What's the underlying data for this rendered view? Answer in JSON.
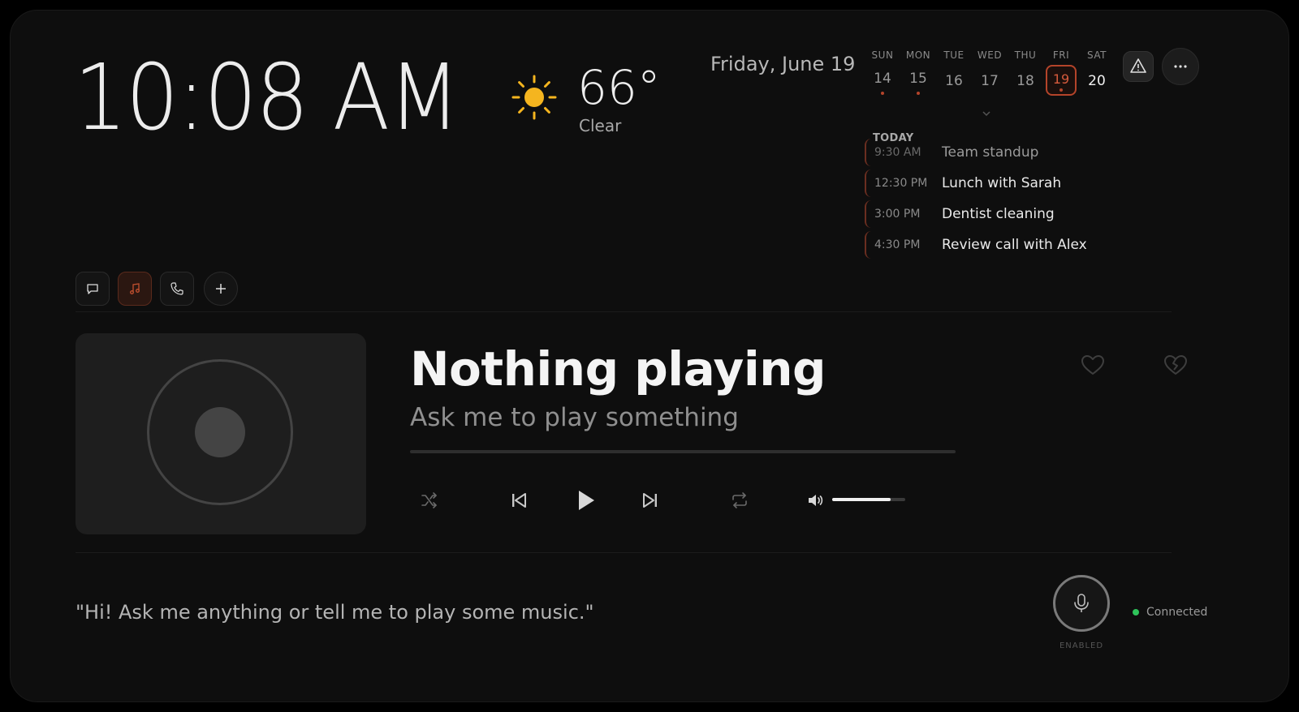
{
  "clock": {
    "time": "10:08 AM"
  },
  "weather": {
    "temperature": "66°",
    "condition": "Clear",
    "icon": "sun-icon",
    "icon_color": "#f5b51f"
  },
  "date": {
    "label": "Friday, June 19"
  },
  "calendar": {
    "days": [
      {
        "name": "SUN",
        "date": "14",
        "has_events": true
      },
      {
        "name": "MON",
        "date": "15",
        "has_events": true
      },
      {
        "name": "TUE",
        "date": "16",
        "has_events": false
      },
      {
        "name": "WED",
        "date": "17",
        "has_events": false
      },
      {
        "name": "THU",
        "date": "18",
        "has_events": false
      },
      {
        "name": "FRI",
        "date": "19",
        "has_events": true,
        "selected": true
      },
      {
        "name": "SAT",
        "date": "20",
        "has_events": false
      }
    ],
    "today_label": "TODAY",
    "events": [
      {
        "time": "9:30 AM",
        "title": "Team standup",
        "past": true
      },
      {
        "time": "12:30 PM",
        "title": "Lunch with Sarah",
        "past": false
      },
      {
        "time": "3:00 PM",
        "title": "Dentist cleaning",
        "past": false
      },
      {
        "time": "4:30 PM",
        "title": "Review call with Alex",
        "past": false
      }
    ],
    "accent_color": "#b4442a"
  },
  "toolbar": {
    "alert_icon": "warning-icon",
    "more_icon": "more-icon"
  },
  "modes": [
    {
      "name": "chat",
      "icon": "chat-icon",
      "active": false
    },
    {
      "name": "music",
      "icon": "music-note-icon",
      "active": true
    },
    {
      "name": "phone",
      "icon": "phone-icon",
      "active": false
    },
    {
      "name": "add",
      "icon": "plus-icon",
      "active": false
    }
  ],
  "player": {
    "title": "Nothing playing",
    "subtitle": "Ask me to play something",
    "progress": 0,
    "volume": 0.8
  },
  "assistant": {
    "prompt": "\"Hi! Ask me anything or tell me to play some music.\"",
    "mic_status": "ENABLED",
    "connection": "Connected",
    "connection_color": "#2ec45a"
  }
}
